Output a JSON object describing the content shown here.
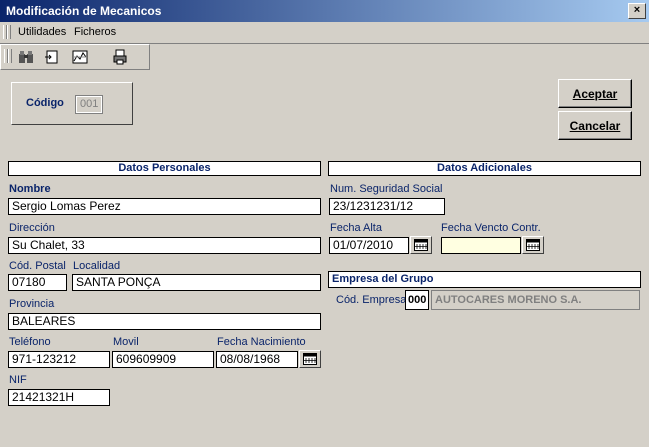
{
  "window": {
    "title": "Modificación de Mecanicos",
    "close_glyph": "×"
  },
  "menu": {
    "utilidades": "Utilidades",
    "ficheros": "Ficheros"
  },
  "toolbar": {
    "icons": [
      "binoculars-icon",
      "exit-door-icon",
      "chart-icon",
      "print-icon"
    ]
  },
  "codigo": {
    "label": "Código",
    "value": "001"
  },
  "buttons": {
    "aceptar": "Aceptar",
    "cancelar": "Cancelar"
  },
  "sections": {
    "personales": "Datos Personales",
    "adicionales": "Datos Adicionales",
    "empresa": "Empresa del Grupo"
  },
  "personal": {
    "nombre_label": "Nombre",
    "nombre": "Sergio Lomas Perez",
    "direccion_label": "Dirección",
    "direccion": "Su Chalet, 33",
    "cp_label": "Cód. Postal",
    "cp": "07180",
    "localidad_label": "Localidad",
    "localidad": "SANTA PONÇA",
    "provincia_label": "Provincia",
    "provincia": "BALEARES",
    "telefono_label": "Teléfono",
    "telefono": "971-123212",
    "movil_label": "Movil",
    "movil": "609609909",
    "nacimiento_label": "Fecha Nacimiento",
    "nacimiento": "08/08/1968",
    "nif_label": "NIF",
    "nif": "21421321H"
  },
  "adicional": {
    "nss_label": "Num. Seguridad Social",
    "nss": "23/1231231/12",
    "alta_label": "Fecha Alta",
    "alta": "01/07/2010",
    "vencto_label": "Fecha Vencto Contr.",
    "vencto": ""
  },
  "empresa": {
    "cod_label": "Cód. Empresa",
    "cod": "000",
    "nombre": "AUTOCARES MORENO S.A."
  }
}
